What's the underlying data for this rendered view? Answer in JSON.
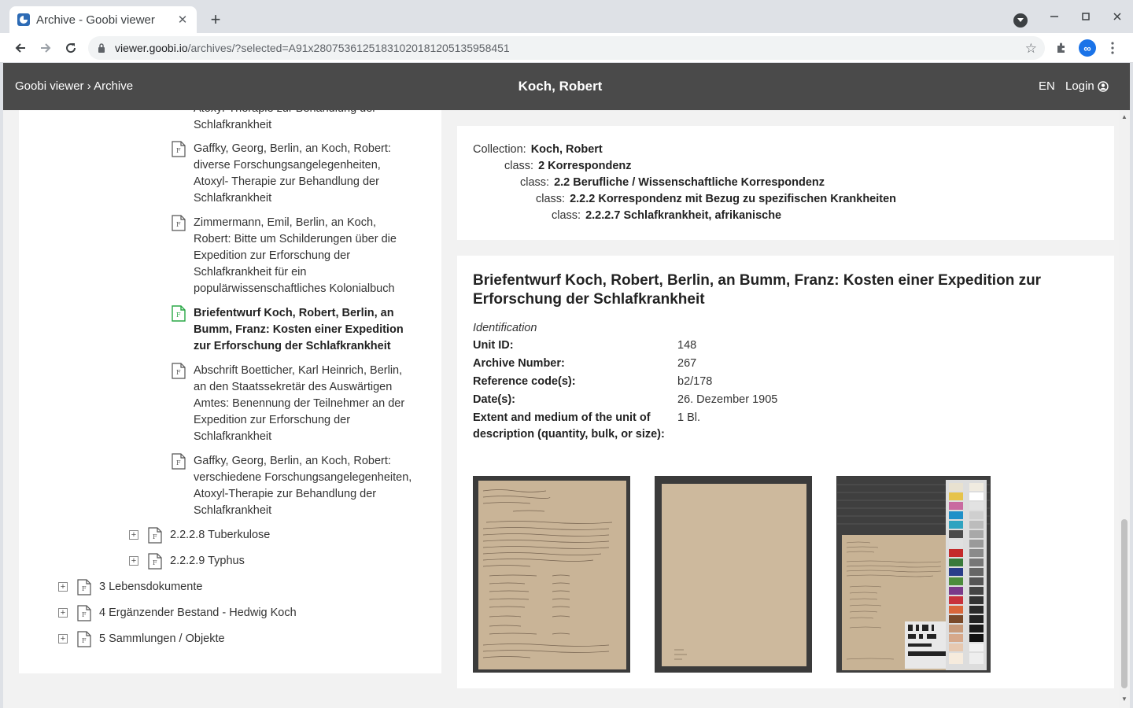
{
  "browser": {
    "tab_title": "Archive - Goobi viewer",
    "tab_close": "✕",
    "new_tab": "+",
    "url_domain": "viewer.goobi.io",
    "url_path": "/archives/?selected=A91x28075361251831020181205135958451",
    "ext_avatar": "∞"
  },
  "header": {
    "breadcrumb_home": "Goobi viewer",
    "breadcrumb_sep": " › ",
    "breadcrumb_current": "Archive",
    "title": "Koch, Robert",
    "language": "EN",
    "login": "Login"
  },
  "tree": {
    "partial_top": [
      "Atoxyl-Therapie zur Behandlung der",
      "Schlafkrankheit"
    ],
    "items": [
      {
        "lines": [
          "Gaffky, Georg, Berlin, an Koch, Robert:",
          "diverse Forschungsangelegenheiten,",
          "Atoxyl- Therapie zur Behandlung der",
          "Schlafkrankheit"
        ]
      },
      {
        "lines": [
          "Zimmermann, Emil, Berlin, an Koch,",
          "Robert: Bitte um Schilderungen über die",
          "Expedition zur Erforschung der",
          "Schlafkrankheit für ein",
          "populärwissenschaftliches Kolonialbuch"
        ]
      },
      {
        "lines": [
          "Briefentwurf Koch, Robert, Berlin, an",
          "Bumm, Franz: Kosten einer Expedition",
          "zur Erforschung der Schlafkrankheit"
        ],
        "active": true
      },
      {
        "lines": [
          "Abschrift Boetticher, Karl Heinrich, Berlin,",
          "an den Staatssekretär des Auswärtigen",
          "Amtes: Benennung der Teilnehmer an der",
          "Expedition zur Erforschung der",
          "Schlafkrankheit"
        ]
      },
      {
        "lines": [
          "Gaffky, Georg, Berlin, an Koch, Robert:",
          "verschiedene Forschungsangelegenheiten,",
          "Atoxyl-Therapie zur Behandlung der",
          "Schlafkrankheit"
        ]
      }
    ],
    "subsections": [
      "2.2.2.8 Tuberkulose",
      "2.2.2.9 Typhus"
    ],
    "sections": [
      "3 Lebensdokumente",
      "4 Ergänzender Bestand - Hedwig Koch",
      "5 Sammlungen / Objekte"
    ],
    "expand_symbol": "+"
  },
  "collection": {
    "rows": [
      {
        "label": "Collection:",
        "value": "Koch, Robert"
      },
      {
        "label": "class:",
        "value": "2 Korrespondenz"
      },
      {
        "label": "class:",
        "value": "2.2 Berufliche / Wissenschaftliche Korrespondenz"
      },
      {
        "label": "class:",
        "value": "2.2.2 Korrespondenz mit Bezug zu spezifischen Krankheiten"
      },
      {
        "label": "class:",
        "value": "2.2.2.7 Schlafkrankheit, afrikanische"
      }
    ]
  },
  "record": {
    "title": "Briefentwurf Koch, Robert, Berlin, an Bumm, Franz: Kosten einer Expedition zur Erforschung der Schlafkrankheit",
    "section": "Identification",
    "fields": [
      {
        "label": "Unit ID:",
        "value": "148"
      },
      {
        "label": "Archive Number:",
        "value": "267"
      },
      {
        "label": "Reference code(s):",
        "value": "b2/178"
      },
      {
        "label": "Date(s):",
        "value": "26. Dezember 1905"
      },
      {
        "label": "Extent and medium of the unit of description (quantity, bulk, or size):",
        "value": "1 Bl."
      }
    ]
  },
  "icons": {
    "back": "arrow-left-icon",
    "forward": "arrow-right-icon",
    "reload": "reload-icon",
    "lock": "lock-icon",
    "bookmark": "star-icon",
    "extensions": "puzzle-icon",
    "menu": "kebab-menu-icon",
    "document": "document-icon",
    "user": "user-circle-icon"
  },
  "colors": {
    "header_bg": "#4a4a4a",
    "active_doc_icon": "#28a745",
    "accent_blue": "#1a73e8"
  }
}
